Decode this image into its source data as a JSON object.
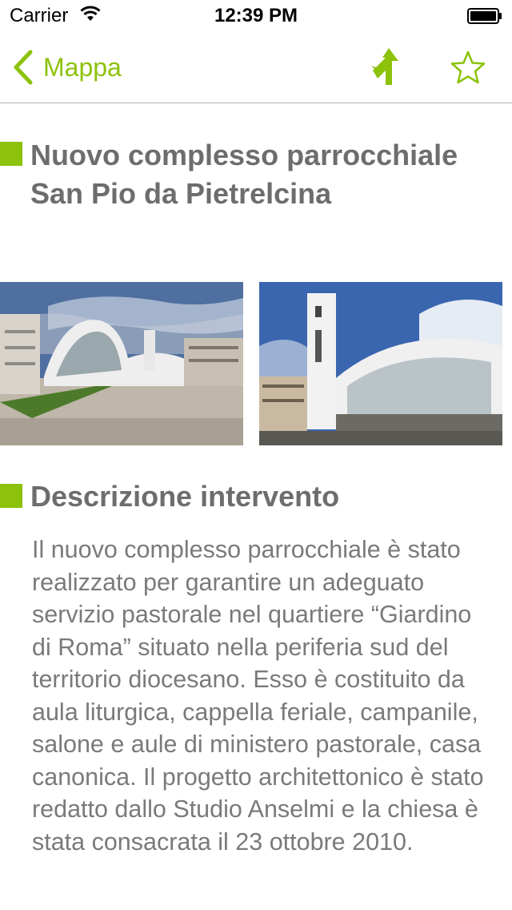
{
  "status_bar": {
    "carrier": "Carrier",
    "time": "12:39 PM"
  },
  "nav": {
    "back_label": "Mappa",
    "back_icon": "chevron-left-icon",
    "directions_icon": "directions-icon",
    "favorite_icon": "star-outline-icon"
  },
  "content": {
    "title": "Nuovo complesso parrocchiale San Pio da Pietrelcina",
    "photos": [
      "church-photo-1",
      "church-photo-2"
    ],
    "section_title": "Descrizione intervento",
    "description": "Il nuovo complesso parrocchiale è stato realizzato per garantire un adeguato servizio pastorale nel quartiere “Giardino di Roma” situato nella periferia sud del territorio diocesano. Esso è costituito da aula liturgica, cappella feriale, campanile, salone e aule di ministero pastorale, casa canonica. Il progetto architettonico è stato redatto dallo Studio Anselmi e la chiesa è stata consacrata il 23 ottobre 2010."
  },
  "colors": {
    "accent": "#8cc20a",
    "heading": "#6d6d6d",
    "body": "#7a7a7a",
    "divider": "#b2b2b2"
  }
}
